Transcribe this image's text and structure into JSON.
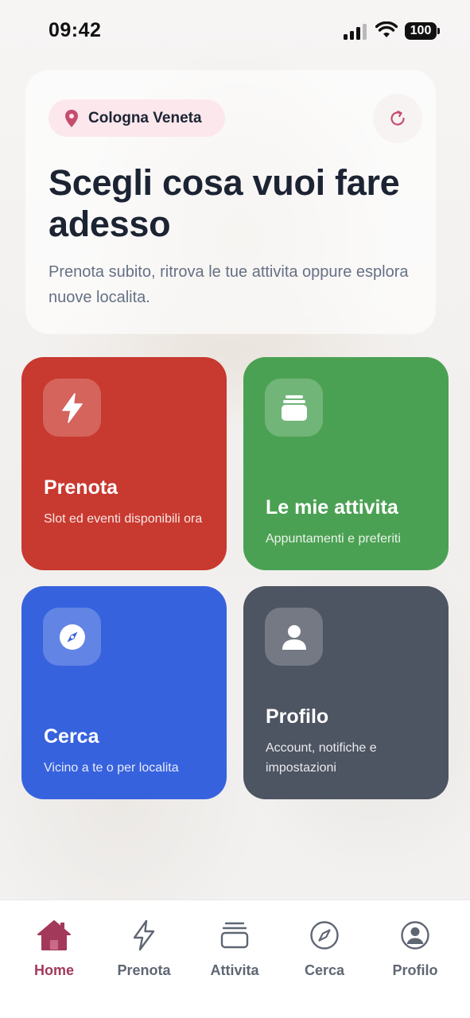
{
  "status_bar": {
    "time": "09:42",
    "battery": "100"
  },
  "hero": {
    "location": "Cologna Veneta",
    "title": "Scegli cosa vuoi fare adesso",
    "subtitle": "Prenota subito, ritrova le tue attivita oppure esplora nuove localita."
  },
  "tiles": [
    {
      "title": "Prenota",
      "subtitle": "Slot ed eventi disponibili ora",
      "icon": "bolt-icon",
      "color": "#c8392f"
    },
    {
      "title": "Le mie attivita",
      "subtitle": "Appuntamenti e preferiti",
      "icon": "stack-icon",
      "color": "#4ba153"
    },
    {
      "title": "Cerca",
      "subtitle": "Vicino a te o per localita",
      "icon": "compass-icon",
      "color": "#3762de"
    },
    {
      "title": "Profilo",
      "subtitle": "Account, notifiche e impostazioni",
      "icon": "person-icon",
      "color": "#4d5462"
    }
  ],
  "tab_bar": {
    "items": [
      {
        "label": "Home",
        "icon": "home-icon",
        "active": true
      },
      {
        "label": "Prenota",
        "icon": "bolt-icon",
        "active": false
      },
      {
        "label": "Attivita",
        "icon": "stack-icon",
        "active": false
      },
      {
        "label": "Cerca",
        "icon": "compass-icon",
        "active": false
      },
      {
        "label": "Profilo",
        "icon": "person-icon",
        "active": false
      }
    ]
  },
  "colors": {
    "accent": "#a3395a",
    "pill_bg": "#fbe7ec"
  }
}
